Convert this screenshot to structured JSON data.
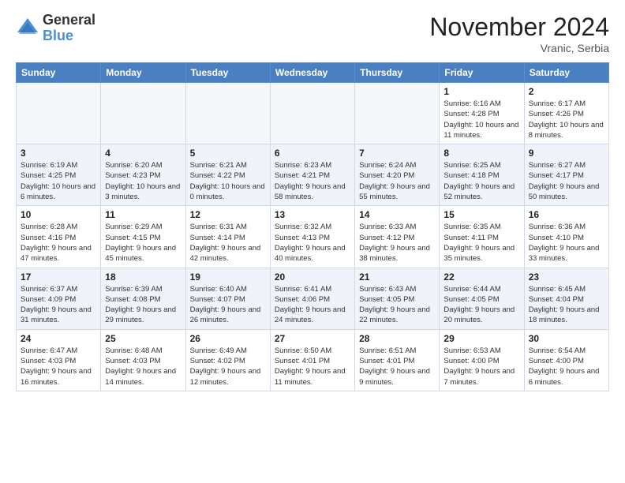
{
  "logo": {
    "general": "General",
    "blue": "Blue"
  },
  "header": {
    "month": "November 2024",
    "location": "Vranic, Serbia"
  },
  "weekdays": [
    "Sunday",
    "Monday",
    "Tuesday",
    "Wednesday",
    "Thursday",
    "Friday",
    "Saturday"
  ],
  "weeks": [
    [
      {
        "day": "",
        "info": ""
      },
      {
        "day": "",
        "info": ""
      },
      {
        "day": "",
        "info": ""
      },
      {
        "day": "",
        "info": ""
      },
      {
        "day": "",
        "info": ""
      },
      {
        "day": "1",
        "info": "Sunrise: 6:16 AM\nSunset: 4:28 PM\nDaylight: 10 hours and 11 minutes."
      },
      {
        "day": "2",
        "info": "Sunrise: 6:17 AM\nSunset: 4:26 PM\nDaylight: 10 hours and 8 minutes."
      }
    ],
    [
      {
        "day": "3",
        "info": "Sunrise: 6:19 AM\nSunset: 4:25 PM\nDaylight: 10 hours and 6 minutes."
      },
      {
        "day": "4",
        "info": "Sunrise: 6:20 AM\nSunset: 4:23 PM\nDaylight: 10 hours and 3 minutes."
      },
      {
        "day": "5",
        "info": "Sunrise: 6:21 AM\nSunset: 4:22 PM\nDaylight: 10 hours and 0 minutes."
      },
      {
        "day": "6",
        "info": "Sunrise: 6:23 AM\nSunset: 4:21 PM\nDaylight: 9 hours and 58 minutes."
      },
      {
        "day": "7",
        "info": "Sunrise: 6:24 AM\nSunset: 4:20 PM\nDaylight: 9 hours and 55 minutes."
      },
      {
        "day": "8",
        "info": "Sunrise: 6:25 AM\nSunset: 4:18 PM\nDaylight: 9 hours and 52 minutes."
      },
      {
        "day": "9",
        "info": "Sunrise: 6:27 AM\nSunset: 4:17 PM\nDaylight: 9 hours and 50 minutes."
      }
    ],
    [
      {
        "day": "10",
        "info": "Sunrise: 6:28 AM\nSunset: 4:16 PM\nDaylight: 9 hours and 47 minutes."
      },
      {
        "day": "11",
        "info": "Sunrise: 6:29 AM\nSunset: 4:15 PM\nDaylight: 9 hours and 45 minutes."
      },
      {
        "day": "12",
        "info": "Sunrise: 6:31 AM\nSunset: 4:14 PM\nDaylight: 9 hours and 42 minutes."
      },
      {
        "day": "13",
        "info": "Sunrise: 6:32 AM\nSunset: 4:13 PM\nDaylight: 9 hours and 40 minutes."
      },
      {
        "day": "14",
        "info": "Sunrise: 6:33 AM\nSunset: 4:12 PM\nDaylight: 9 hours and 38 minutes."
      },
      {
        "day": "15",
        "info": "Sunrise: 6:35 AM\nSunset: 4:11 PM\nDaylight: 9 hours and 35 minutes."
      },
      {
        "day": "16",
        "info": "Sunrise: 6:36 AM\nSunset: 4:10 PM\nDaylight: 9 hours and 33 minutes."
      }
    ],
    [
      {
        "day": "17",
        "info": "Sunrise: 6:37 AM\nSunset: 4:09 PM\nDaylight: 9 hours and 31 minutes."
      },
      {
        "day": "18",
        "info": "Sunrise: 6:39 AM\nSunset: 4:08 PM\nDaylight: 9 hours and 29 minutes."
      },
      {
        "day": "19",
        "info": "Sunrise: 6:40 AM\nSunset: 4:07 PM\nDaylight: 9 hours and 26 minutes."
      },
      {
        "day": "20",
        "info": "Sunrise: 6:41 AM\nSunset: 4:06 PM\nDaylight: 9 hours and 24 minutes."
      },
      {
        "day": "21",
        "info": "Sunrise: 6:43 AM\nSunset: 4:05 PM\nDaylight: 9 hours and 22 minutes."
      },
      {
        "day": "22",
        "info": "Sunrise: 6:44 AM\nSunset: 4:05 PM\nDaylight: 9 hours and 20 minutes."
      },
      {
        "day": "23",
        "info": "Sunrise: 6:45 AM\nSunset: 4:04 PM\nDaylight: 9 hours and 18 minutes."
      }
    ],
    [
      {
        "day": "24",
        "info": "Sunrise: 6:47 AM\nSunset: 4:03 PM\nDaylight: 9 hours and 16 minutes."
      },
      {
        "day": "25",
        "info": "Sunrise: 6:48 AM\nSunset: 4:03 PM\nDaylight: 9 hours and 14 minutes."
      },
      {
        "day": "26",
        "info": "Sunrise: 6:49 AM\nSunset: 4:02 PM\nDaylight: 9 hours and 12 minutes."
      },
      {
        "day": "27",
        "info": "Sunrise: 6:50 AM\nSunset: 4:01 PM\nDaylight: 9 hours and 11 minutes."
      },
      {
        "day": "28",
        "info": "Sunrise: 6:51 AM\nSunset: 4:01 PM\nDaylight: 9 hours and 9 minutes."
      },
      {
        "day": "29",
        "info": "Sunrise: 6:53 AM\nSunset: 4:00 PM\nDaylight: 9 hours and 7 minutes."
      },
      {
        "day": "30",
        "info": "Sunrise: 6:54 AM\nSunset: 4:00 PM\nDaylight: 9 hours and 6 minutes."
      }
    ]
  ]
}
